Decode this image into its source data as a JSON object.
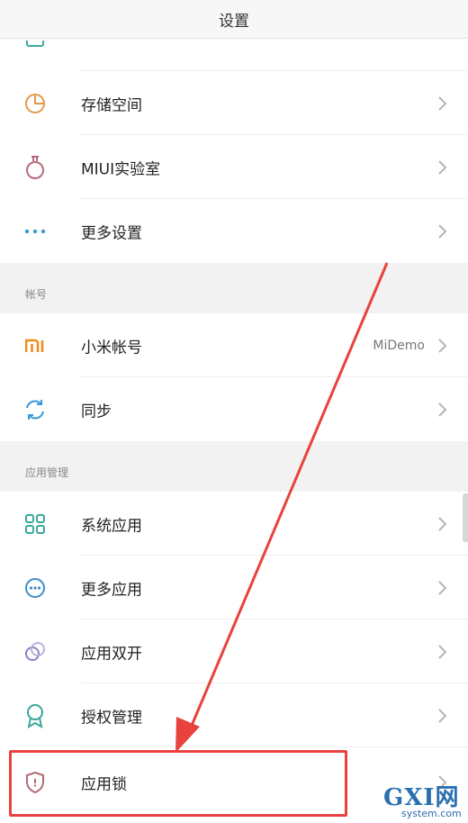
{
  "header": {
    "title": "设置"
  },
  "group1": {
    "items": [
      {
        "label": "存储空间",
        "icon": "storage-pie-icon"
      },
      {
        "label": "MIUI实验室",
        "icon": "lab-flask-icon"
      },
      {
        "label": "更多设置",
        "icon": "more-dots-icon"
      }
    ]
  },
  "account": {
    "section_label": "帐号",
    "items": [
      {
        "label": "小米帐号",
        "value": "MiDemo",
        "icon": "mi-logo-icon"
      },
      {
        "label": "同步",
        "icon": "sync-icon"
      }
    ]
  },
  "apps": {
    "section_label": "应用管理",
    "items": [
      {
        "label": "系统应用",
        "icon": "grid-apps-icon"
      },
      {
        "label": "更多应用",
        "icon": "more-circle-icon"
      },
      {
        "label": "应用双开",
        "icon": "dual-circles-icon"
      },
      {
        "label": "授权管理",
        "icon": "badge-icon"
      },
      {
        "label": "应用锁",
        "icon": "shield-lock-icon"
      }
    ]
  },
  "watermark": {
    "brand": "GXI网",
    "site": "system.com"
  },
  "colors": {
    "accent_red": "#e8423f",
    "mi_orange": "#f08c1a",
    "teal": "#3aa89a"
  }
}
